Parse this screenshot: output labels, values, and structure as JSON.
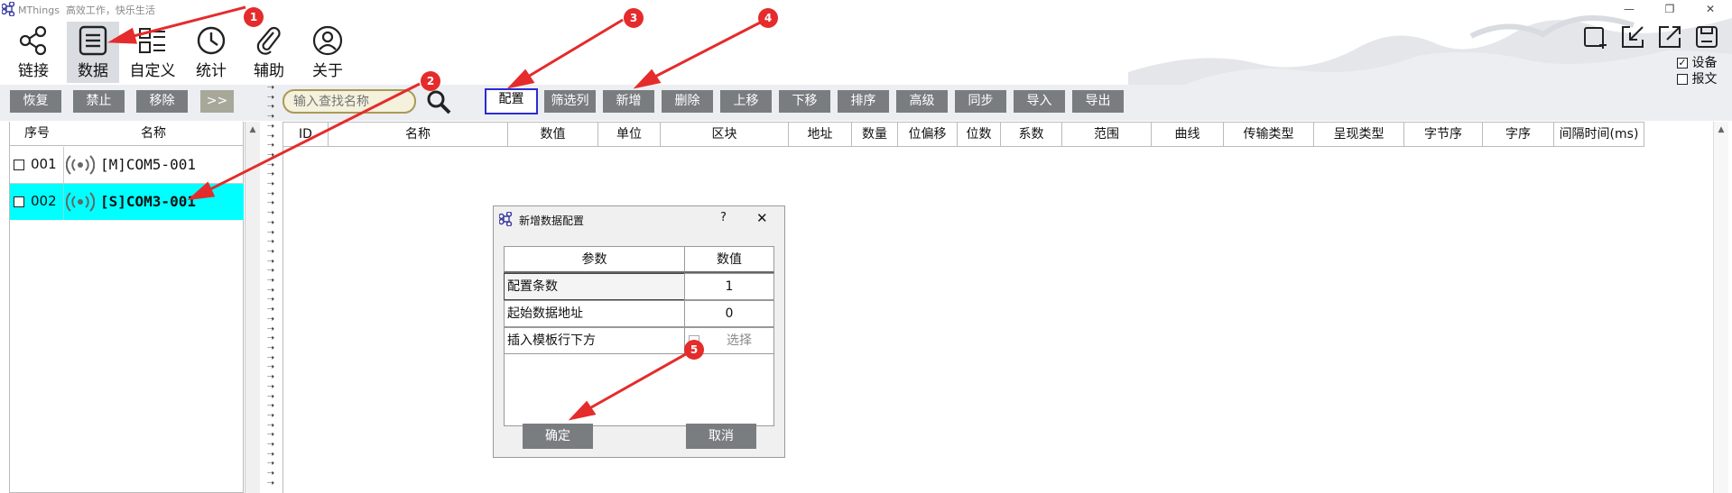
{
  "window": {
    "app_name": "MThings",
    "slogan": "高效工作，快乐生活",
    "minimize": "—",
    "restore": "❐",
    "close": "✕"
  },
  "toolbar": [
    {
      "label": "链接",
      "icon": "link-icon"
    },
    {
      "label": "数据",
      "icon": "document-list-icon"
    },
    {
      "label": "自定义",
      "icon": "custom-layout-icon"
    },
    {
      "label": "统计",
      "icon": "clock-icon"
    },
    {
      "label": "辅助",
      "icon": "paperclip-icon"
    },
    {
      "label": "关于",
      "icon": "user-icon"
    }
  ],
  "right_options": {
    "device_label": "设备",
    "device_checked": true,
    "message_label": "报文",
    "message_checked": false
  },
  "left_actions": {
    "restore": "恢复",
    "disable": "禁止",
    "remove": "移除",
    "expand": ">>"
  },
  "search": {
    "placeholder": "输入查找名称",
    "value": ""
  },
  "actions": {
    "config": "配置",
    "filter": "筛选列",
    "add": "新增",
    "delete": "删除",
    "move_up": "上移",
    "move_down": "下移",
    "sort": "排序",
    "advanced": "高级",
    "sync": "同步",
    "import": "导入",
    "export": "导出"
  },
  "device_list": {
    "headers": {
      "index": "序号",
      "name": "名称"
    },
    "rows": [
      {
        "index": "001",
        "name": "[M]COM5-001",
        "selected": false
      },
      {
        "index": "002",
        "name": "[S]COM3-001",
        "selected": true
      }
    ]
  },
  "data_table": {
    "headers": [
      "ID",
      "名称",
      "数值",
      "单位",
      "区块",
      "地址",
      "数量",
      "位偏移",
      "位数",
      "系数",
      "范围",
      "曲线",
      "传输类型",
      "呈现类型",
      "字节序",
      "字序",
      "间隔时间(ms)"
    ]
  },
  "dialog": {
    "title": "新增数据配置",
    "help": "?",
    "close": "✕",
    "headers": {
      "param": "参数",
      "value": "数值"
    },
    "rows": [
      {
        "param": "配置条数",
        "value": "1"
      },
      {
        "param": "起始数据地址",
        "value": "0"
      },
      {
        "param": "插入模板行下方",
        "value": "选择"
      }
    ],
    "ok": "确定",
    "cancel": "取消"
  },
  "annotations": [
    "1",
    "2",
    "3",
    "4",
    "5"
  ],
  "colors": {
    "accent_red": "#e52b2b",
    "selected_row": "#00ffff",
    "button_gray": "#7a7d80",
    "focus_blue": "#2b2bd6"
  }
}
